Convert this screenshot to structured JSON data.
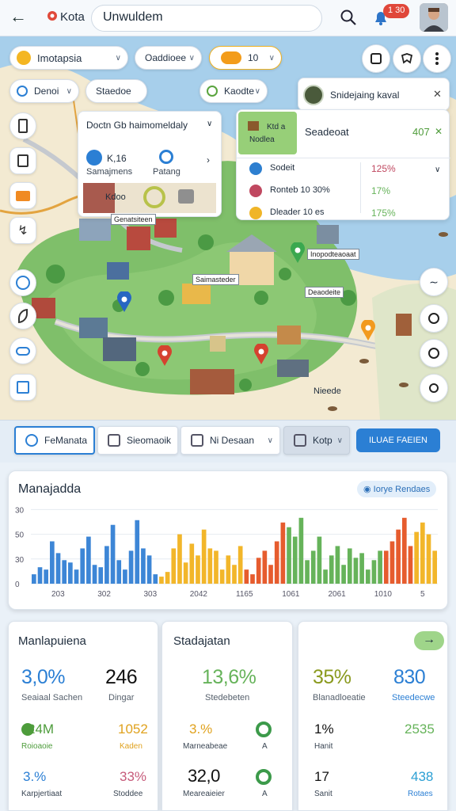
{
  "header": {
    "back_label": "←",
    "app_name": "Kota",
    "search_value": "Unwuldem",
    "notification_count": "1 30"
  },
  "filters": {
    "region": "Imotapsia",
    "category": "Oaddioee",
    "toggle": "10",
    "type1": "Denoi",
    "type2": "Staedoe",
    "type3": "Kaodte"
  },
  "detail_card": {
    "title": "Doctn Gb haimomeldaly",
    "stat1_value": "K,16",
    "stat1_label": "Samajmens",
    "stat2_label": "Patang",
    "image_caption": "Kdoo",
    "footer": "Genatsiteen"
  },
  "right_card": {
    "user": "Snidejaing kaval",
    "tile_line1": "Ktd a",
    "tile_line2": "Nodlea",
    "title": "Seadeoat",
    "value": "407",
    "rows": [
      {
        "label": "Sodeit",
        "value": "125%",
        "color": "#2d7fd0"
      },
      {
        "label": "Ronteb 10 30%",
        "value": "17%",
        "color": "#c04860"
      },
      {
        "label": "Dleader 10 es",
        "value": "175%",
        "color": "#f0b528"
      }
    ]
  },
  "map_labels": {
    "l1": "Saimasteder",
    "l2": "Deaodeite",
    "l3": "Inopodteaoaat",
    "l4": "Nieede"
  },
  "tabs": [
    {
      "label": "FeManata"
    },
    {
      "label": "Sieomaoik"
    },
    {
      "label": "Ni Desaan"
    },
    {
      "label": "Kotp"
    }
  ],
  "action_button": "ILUAE FAEIEN",
  "chart_panel": {
    "title": "Manajadda",
    "chip": "Iorye Rendaes"
  },
  "chart_data": {
    "type": "bar",
    "title": "Manajadda",
    "ylim": [
      0,
      35
    ],
    "yticks": [
      "30",
      "50",
      "30",
      "0"
    ],
    "xticks": [
      "203",
      "302",
      "303",
      "2042",
      "1165",
      "1061",
      "2061",
      "1010",
      "5"
    ],
    "series": [
      {
        "color": "#3d86d6",
        "values": [
          4,
          7,
          6,
          18,
          13,
          10,
          9,
          6,
          15,
          20,
          8,
          7,
          16,
          25,
          10,
          6,
          14,
          27,
          15,
          12,
          4
        ]
      },
      {
        "color": "#f2b62a",
        "values": [
          3,
          5,
          15,
          21,
          9,
          17,
          12,
          23,
          15,
          14,
          6,
          12,
          8,
          16
        ]
      },
      {
        "color": "#e65c2e",
        "values": [
          6,
          4,
          11,
          14,
          8,
          18,
          26
        ]
      },
      {
        "color": "#66b35a",
        "values": [
          24,
          20,
          28,
          10,
          14,
          20,
          6,
          12,
          16,
          8,
          15,
          11,
          13,
          6,
          10,
          14
        ]
      },
      {
        "color": "#e65c2e",
        "values": [
          14,
          18,
          23,
          28,
          16
        ]
      },
      {
        "color": "#f2b62a",
        "values": [
          22,
          26,
          21,
          14
        ]
      }
    ]
  },
  "stats": {
    "panel1": {
      "title": "Manlapuiena",
      "main": [
        {
          "value": "3,0%",
          "label": "Seaiaal Sachen"
        },
        {
          "value": "246",
          "label": "Dingar"
        }
      ],
      "rows": [
        {
          "value": "24M",
          "label": "Roioaoie",
          "value2": "1052",
          "label2": "Kaden"
        },
        {
          "value": "3.%",
          "label": "Karpjertiaat",
          "value2": "33%",
          "label2": "Stoddee"
        }
      ]
    },
    "panel2": {
      "title": "Stadajatan",
      "main": [
        {
          "value": "13,6%",
          "label": "Stedebeten"
        }
      ],
      "rows": [
        {
          "value": "3.%",
          "label": "Marneabeae",
          "label2": "A"
        },
        {
          "value": "32,0",
          "label": "Meareaieier",
          "label2": "A"
        }
      ]
    },
    "panel3": {
      "main": [
        {
          "value": "35%",
          "label": "Blanadloeatie"
        },
        {
          "value": "830",
          "label": "Steedecwe"
        }
      ],
      "rows": [
        {
          "value": "1%",
          "label": "Hanit",
          "value2": "2535"
        },
        {
          "value": "17",
          "label": "Sanit",
          "value2": "438",
          "label2": "Rotaes"
        }
      ]
    }
  },
  "colors": {
    "accent": "#2b7fd4",
    "green": "#66b35a",
    "orange": "#f2b62a",
    "red": "#e65c2e"
  }
}
